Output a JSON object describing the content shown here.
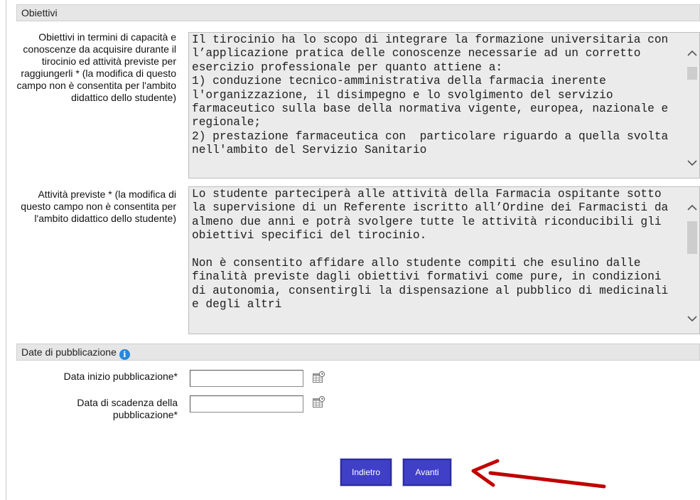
{
  "sections": {
    "obiettivi_title": "Obiettivi",
    "date_title": "Date di pubblicazione"
  },
  "fields": {
    "obiettivi_label": "Obiettivi in termini di capacità e conoscenze da acquisire durante il tirocinio ed attività previste per raggiungerli * (la modifica di questo campo non è consentita per l'ambito didattico dello studente)",
    "obiettivi_text": "Il tirocinio ha lo scopo di integrare la formazione universitaria con l’applicazione pratica delle conoscenze necessarie ad un corretto esercizio professionale per quanto attiene a:\n1) conduzione tecnico-amministrativa della farmacia inerente l'organizzazione, il disimpegno e lo svolgimento del servizio farmaceutico sulla base della normativa vigente, europea, nazionale e regionale;\n2) prestazione farmaceutica con  particolare riguardo a quella svolta nell'ambito del Servizio Sanitario",
    "attivita_label": "Attività previste * (la modifica di questo campo non è consentita per l'ambito didattico dello studente)",
    "attivita_text": "Lo studente parteciperà alle attività della Farmacia ospitante sotto la supervisione di un Referente iscritto all’Ordine dei Farmacisti da almeno due anni e potrà svolgere tutte le attività riconducibili gli obiettivi specifici del tirocinio.\n\nNon è consentito affidare allo studente compiti che esulino dalle finalità previste dagli obiettivi formativi come pure, in condizioni di autonomia, consentirgli la dispensazione al pubblico di medicinali e degli altri",
    "data_inizio_label": "Data inizio pubblicazione*",
    "data_inizio_value": "",
    "data_scadenza_label": "Data di scadenza della pubblicazione*",
    "data_scadenza_value": ""
  },
  "buttons": {
    "back": "Indietro",
    "next": "Avanti"
  },
  "icons": {
    "info": "info-icon",
    "calendar": "calendar-icon",
    "annotation_arrow": "red-arrow"
  },
  "colors": {
    "button_bg": "#3f3fc8",
    "arrow": "#c00000",
    "header_bg": "#e6e6e6",
    "textarea_bg": "#ebebeb"
  }
}
